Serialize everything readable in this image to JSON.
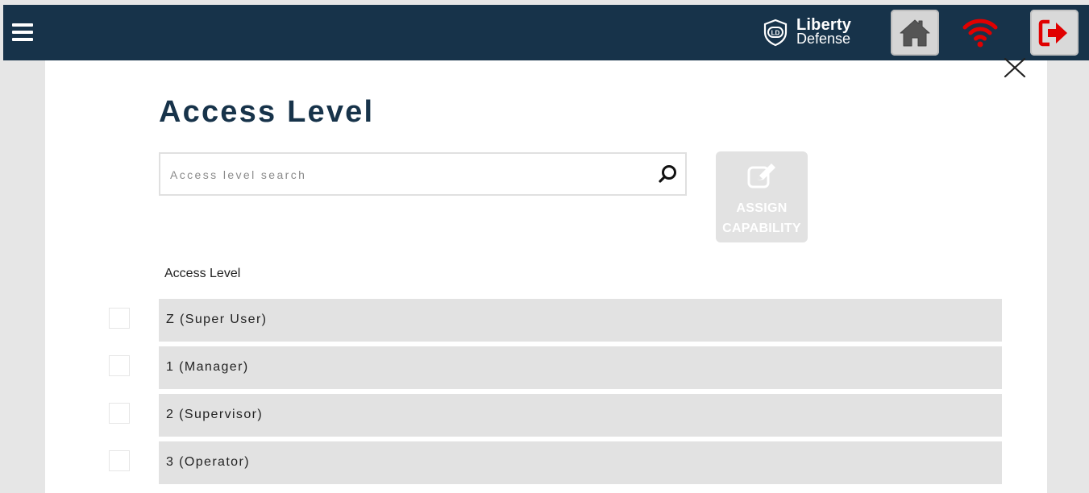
{
  "header": {
    "brand_name": "Liberty",
    "brand_sub": "Defense",
    "brand_mark_text": "LD",
    "icons": {
      "menu": "hamburger-menu-icon",
      "home": "home-icon",
      "wifi": "wifi-signal-icon",
      "logout": "logout-icon"
    },
    "colors": {
      "bar": "#17334a",
      "wifi": "#e00000",
      "logout": "#e00000"
    }
  },
  "page": {
    "title": "Access Level",
    "close_icon": "close-icon"
  },
  "search": {
    "placeholder": "Access level search",
    "value": ""
  },
  "assign": {
    "label": "ASSIGN\nCAPABILITY",
    "icon": "edit-icon"
  },
  "table": {
    "column_header": "Access Level",
    "rows": [
      {
        "label": "Z (Super User)",
        "checked": false
      },
      {
        "label": "1 (Manager)",
        "checked": false
      },
      {
        "label": "2 (Supervisor)",
        "checked": false
      },
      {
        "label": "3 (Operator)",
        "checked": false
      }
    ]
  }
}
